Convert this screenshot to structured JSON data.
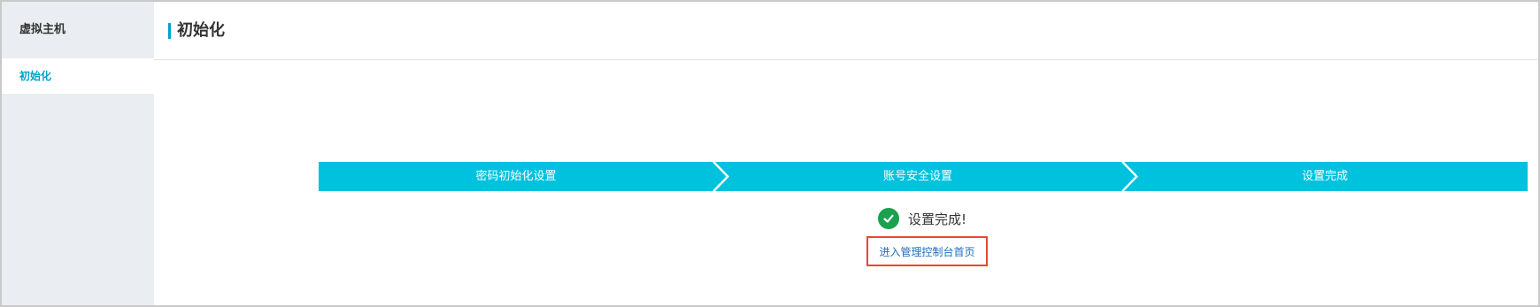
{
  "sidebar": {
    "title": "虚拟主机",
    "items": [
      {
        "label": "初始化",
        "active": true
      }
    ]
  },
  "header": {
    "title": "初始化"
  },
  "steps": [
    {
      "label": "密码初始化设置"
    },
    {
      "label": "账号安全设置"
    },
    {
      "label": "设置完成"
    }
  ],
  "result": {
    "message": "设置完成!",
    "icon": "check-circle-icon",
    "link_label": "进入管理控制台首页"
  },
  "colors": {
    "accent": "#00a2ca",
    "step_bg": "#00c1de",
    "success": "#1aa14d",
    "highlight_border": "#e6482e",
    "link": "#1e6fc1",
    "sidebar_bg": "#eaedf1"
  }
}
